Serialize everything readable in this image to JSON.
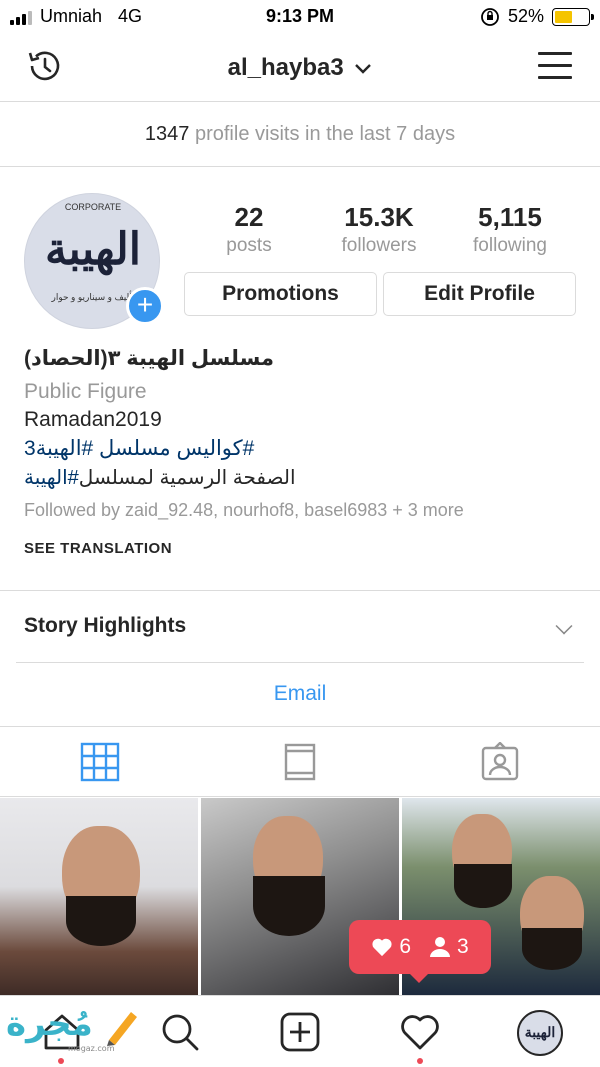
{
  "status_bar": {
    "carrier": "Umniah",
    "network": "4G",
    "time": "9:13 PM",
    "battery": "52%",
    "battery_level": 0.52
  },
  "header": {
    "username": "al_hayba3",
    "history_icon": "history-icon",
    "menu_icon": "hamburger-menu-icon"
  },
  "visits": {
    "count": "1347",
    "text": "profile visits in the last 7 days"
  },
  "profile": {
    "avatar_logo_text": "الهيبة",
    "stats": [
      {
        "value": "22",
        "label": "posts"
      },
      {
        "value": "15.3K",
        "label": "followers"
      },
      {
        "value": "5,115",
        "label": "following"
      }
    ],
    "promotions_label": "Promotions",
    "edit_label": "Edit Profile",
    "name": "مسلسل الهيبة ٣(الحصاد)",
    "category": "Public Figure",
    "bio_line1": "Ramadan2019",
    "bio_line2": "#كواليس مسلسل #الهيبة3",
    "bio_line3_text": "الصفحة الرسمية لمسلسل",
    "bio_line3_tag": "#الهيبة",
    "followed_by": "Followed by zaid_92.48, nourhof8, basel6983 + 3 more",
    "see_translation": "SEE TRANSLATION"
  },
  "story_highlights": {
    "label": "Story Highlights"
  },
  "contact": {
    "email_label": "Email"
  },
  "tabs": [
    {
      "icon": "grid-icon",
      "active": true
    },
    {
      "icon": "feed-icon",
      "active": false
    },
    {
      "icon": "tagged-icon",
      "active": false
    }
  ],
  "notification": {
    "likes": "6",
    "follows": "3"
  },
  "bottom_nav": [
    {
      "icon": "home-icon"
    },
    {
      "icon": "search-icon"
    },
    {
      "icon": "new-post-icon"
    },
    {
      "icon": "activity-heart-icon"
    },
    {
      "icon": "profile-avatar"
    }
  ],
  "watermark": {
    "text": "مُجرة",
    "sub": "mogaz.com"
  },
  "colors": {
    "accent": "#3897f0",
    "notification": "#ed4956",
    "hashtag": "#003569",
    "battery": "#f5c400"
  }
}
